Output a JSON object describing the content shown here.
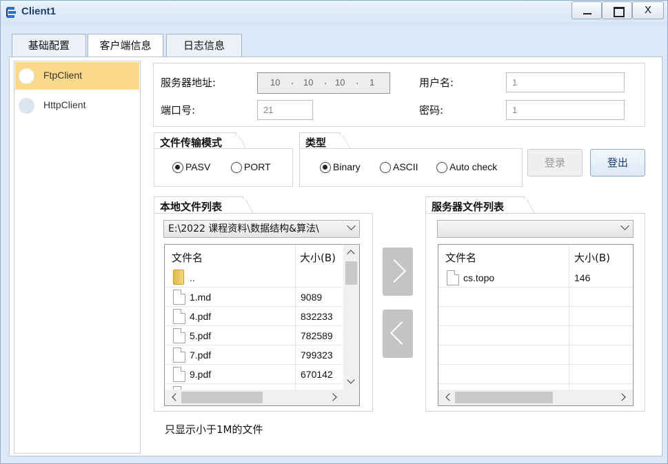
{
  "window": {
    "title": "Client1",
    "close_label": "X"
  },
  "tabs": [
    {
      "label": "基础配置"
    },
    {
      "label": "客户端信息"
    },
    {
      "label": "日志信息"
    }
  ],
  "sidebar": {
    "items": [
      {
        "label": "FtpClient",
        "selected": true
      },
      {
        "label": "HttpClient",
        "selected": false
      }
    ]
  },
  "server": {
    "address_label": "服务器地址:",
    "ip": [
      "10",
      "10",
      "10",
      "1"
    ],
    "port_label": "端口号:",
    "port_value": "21",
    "username_label": "用户名:",
    "username_value": "1",
    "password_label": "密码:",
    "password_value": "1"
  },
  "transfer_mode": {
    "title": "文件传输模式",
    "options": [
      {
        "label": "PASV",
        "checked": true
      },
      {
        "label": "PORT",
        "checked": false
      }
    ]
  },
  "type": {
    "title": "类型",
    "options": [
      {
        "label": "Binary",
        "checked": true
      },
      {
        "label": "ASCII",
        "checked": false
      },
      {
        "label": "Auto check",
        "checked": false
      }
    ]
  },
  "buttons": {
    "login": "登录",
    "logout": "登出"
  },
  "local_files": {
    "title": "本地文件列表",
    "path": "E:\\2022 课程资料\\数据结构&算法\\",
    "columns": {
      "name": "文件名",
      "size": "大小(B)"
    },
    "rows": [
      {
        "name": "..",
        "size": "",
        "kind": "folder"
      },
      {
        "name": "1.md",
        "size": "9089",
        "kind": "file"
      },
      {
        "name": "4.pdf",
        "size": "832233",
        "kind": "file"
      },
      {
        "name": "5.pdf",
        "size": "782589",
        "kind": "file"
      },
      {
        "name": "7.pdf",
        "size": "799323",
        "kind": "file"
      },
      {
        "name": "9.pdf",
        "size": "670142",
        "kind": "file"
      }
    ]
  },
  "server_files": {
    "title": "服务器文件列表",
    "path": "",
    "columns": {
      "name": "文件名",
      "size": "大小(B)"
    },
    "rows": [
      {
        "name": "cs.topo",
        "size": "146",
        "kind": "file"
      }
    ]
  },
  "note": "只显示小于1M的文件",
  "icons": {
    "app": "network-client-icon",
    "upload": "chevron-right-icon",
    "download": "chevron-left-icon"
  }
}
